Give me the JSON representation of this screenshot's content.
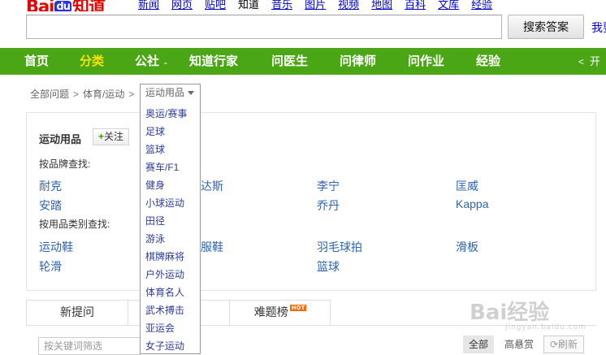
{
  "logo": {
    "left": "Bai",
    "paw": "du",
    "right": "知道"
  },
  "topnav": [
    "新闻",
    "网页",
    "贴吧",
    "知道",
    "音乐",
    "图片",
    "视频",
    "地图",
    "百科",
    "文库",
    "经验"
  ],
  "search": {
    "value": "",
    "button": "搜索答案",
    "ask": "我要"
  },
  "greennav": {
    "items": [
      "首页",
      "分类",
      "公社",
      "知道行家",
      "问医生",
      "问律师",
      "问作业",
      "经验"
    ],
    "caret": "⌄",
    "share": "开"
  },
  "breadcrumb": {
    "items": [
      "全部问题",
      "体育/运动"
    ],
    "sep": ">",
    "current": "运动用品"
  },
  "category": {
    "title": "运动用品",
    "follow": "关注",
    "brand_label": "按品牌查找:",
    "brands": [
      [
        "耐克",
        "阿迪达斯",
        "李宁",
        "匡威"
      ],
      [
        "安踏",
        "",
        "乔丹",
        "Kappa"
      ]
    ],
    "type_label": "按用品类别查找:",
    "types": [
      [
        "运动鞋",
        "运动服鞋",
        "羽毛球拍",
        "滑板"
      ],
      [
        "轮滑",
        "",
        "篮球",
        ""
      ]
    ]
  },
  "dropdown": [
    "奥运/赛事",
    "足球",
    "篮球",
    "赛车/F1",
    "健身",
    "小球运动",
    "田径",
    "游泳",
    "棋牌麻将",
    "户外运动",
    "体育名人",
    "武术搏击",
    "亚运会",
    "女子运动"
  ],
  "tabs": {
    "new": "新提问",
    "hot": "难题榜",
    "hot_badge": "HOT"
  },
  "filter": {
    "placeholder": "按关键词筛选",
    "all": "全部",
    "bounty": "高悬赏",
    "refresh": "刷新"
  },
  "watermark": {
    "main": "Bai经验",
    "sub": "jingyan.baidu.com"
  }
}
